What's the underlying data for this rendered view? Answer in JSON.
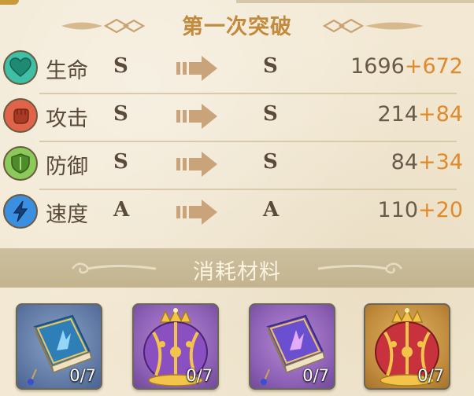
{
  "header": {
    "title": "第一次突破"
  },
  "stats": [
    {
      "label": "生命",
      "icon": "heart-icon",
      "color": "#3fbfa5",
      "from": "S",
      "to": "S",
      "base": "1696",
      "bonus": "+672"
    },
    {
      "label": "攻击",
      "icon": "fist-icon",
      "color": "#e0644a",
      "from": "S",
      "to": "S",
      "base": "214",
      "bonus": "+84"
    },
    {
      "label": "防御",
      "icon": "shield-icon",
      "color": "#8cc85a",
      "from": "S",
      "to": "S",
      "base": "84",
      "bonus": "+34"
    },
    {
      "label": "速度",
      "icon": "lightning-icon",
      "color": "#3a8fe0",
      "from": "A",
      "to": "A",
      "base": "110",
      "bonus": "+20"
    }
  ],
  "materials": {
    "title": "消耗材料",
    "items": [
      {
        "icon": "blue-book-icon",
        "count": "0/7",
        "frame": "blue"
      },
      {
        "icon": "purple-crown-icon",
        "count": "0/7",
        "frame": "purple"
      },
      {
        "icon": "purple-book-icon",
        "count": "0/7",
        "frame": "purple"
      },
      {
        "icon": "red-crown-icon",
        "count": "0/7",
        "frame": "gold"
      }
    ]
  },
  "colors": {
    "accent_text": "#c28a3f",
    "bonus": "#e08a2c",
    "text": "#5a4a3a",
    "background": "#f2e8d3"
  }
}
